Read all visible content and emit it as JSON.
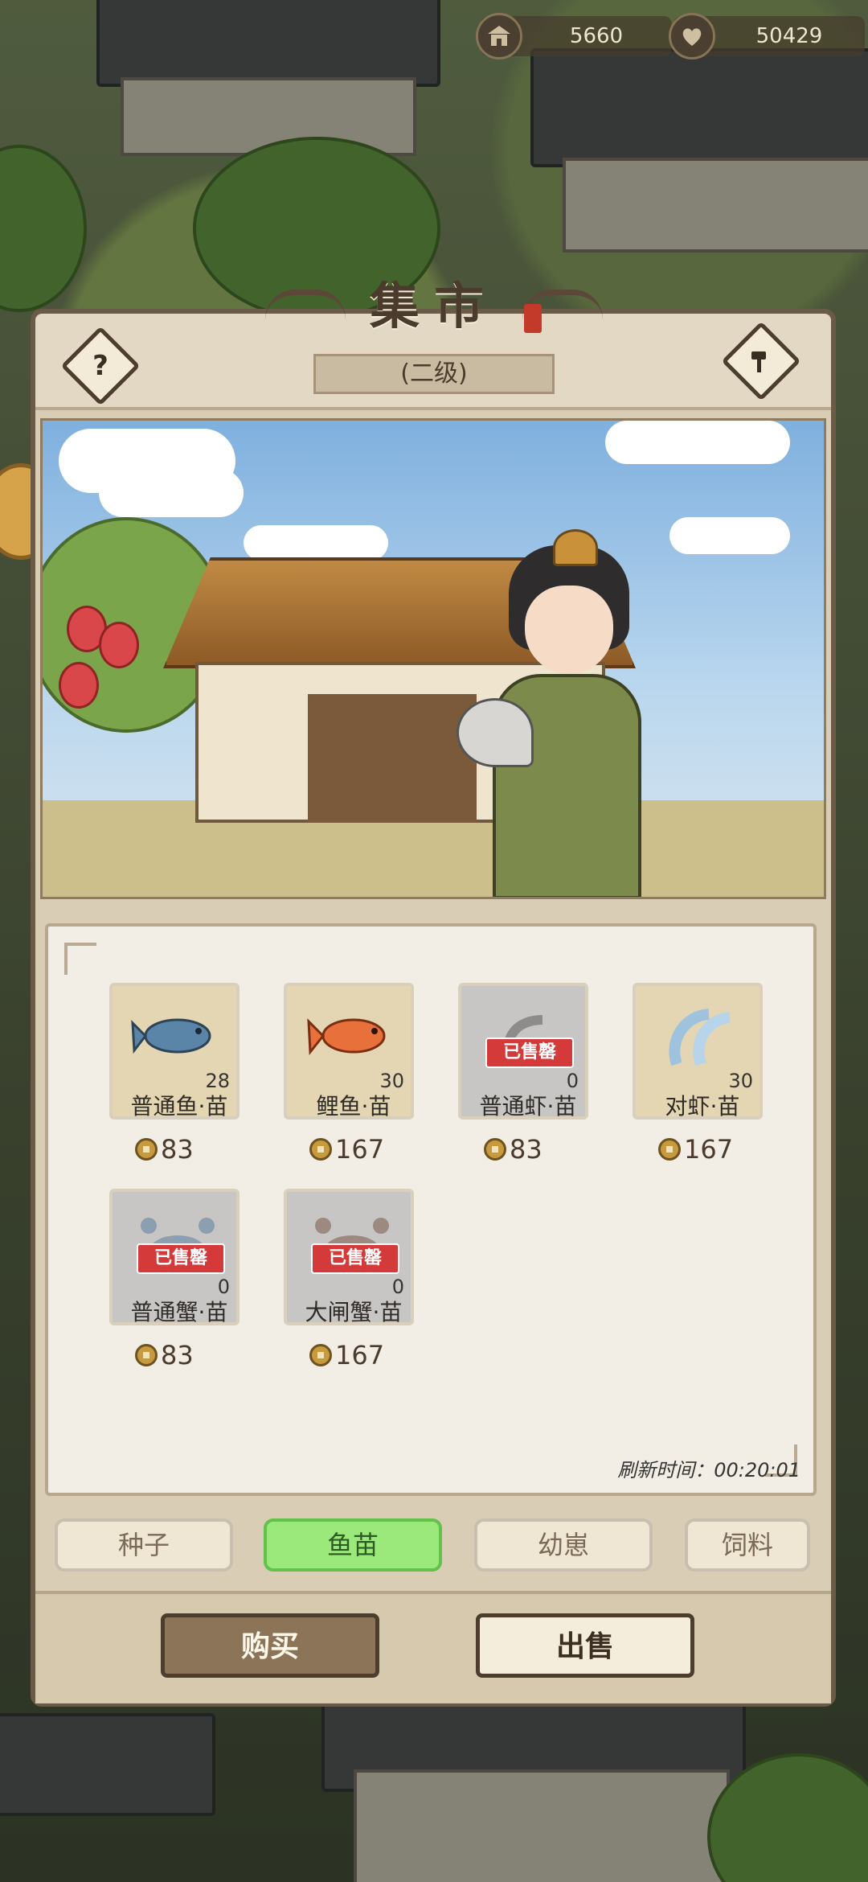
{
  "currency": {
    "building_value": "5660",
    "heart_value": "50429"
  },
  "panel": {
    "title": "集市",
    "level": "(二级)"
  },
  "items": [
    {
      "name": "普通鱼·苗",
      "count": "28",
      "price": "83",
      "sold_out": false
    },
    {
      "name": "鲤鱼·苗",
      "count": "30",
      "price": "167",
      "sold_out": false
    },
    {
      "name": "普通虾·苗",
      "count": "0",
      "price": "83",
      "sold_out": true
    },
    {
      "name": "对虾·苗",
      "count": "30",
      "price": "167",
      "sold_out": false
    },
    {
      "name": "普通蟹·苗",
      "count": "0",
      "price": "83",
      "sold_out": true
    },
    {
      "name": "大闸蟹·苗",
      "count": "0",
      "price": "167",
      "sold_out": true
    }
  ],
  "sold_out_label": "已售罄",
  "refresh": {
    "label": "刷新时间：",
    "time": "00:20:01"
  },
  "tabs": [
    {
      "label": "种子",
      "active": false
    },
    {
      "label": "鱼苗",
      "active": true
    },
    {
      "label": "幼崽",
      "active": false
    },
    {
      "label": "饲料",
      "active": false
    }
  ],
  "actions": {
    "buy": "购买",
    "sell": "出售"
  },
  "colors": {
    "active_tab": "#9ae97a",
    "sold_stamp": "#d43a39",
    "panel_border": "#6b5a45"
  },
  "icons": [
    "building-icon",
    "heart-icon",
    "help-icon",
    "hammer-icon",
    "coin-icon"
  ]
}
